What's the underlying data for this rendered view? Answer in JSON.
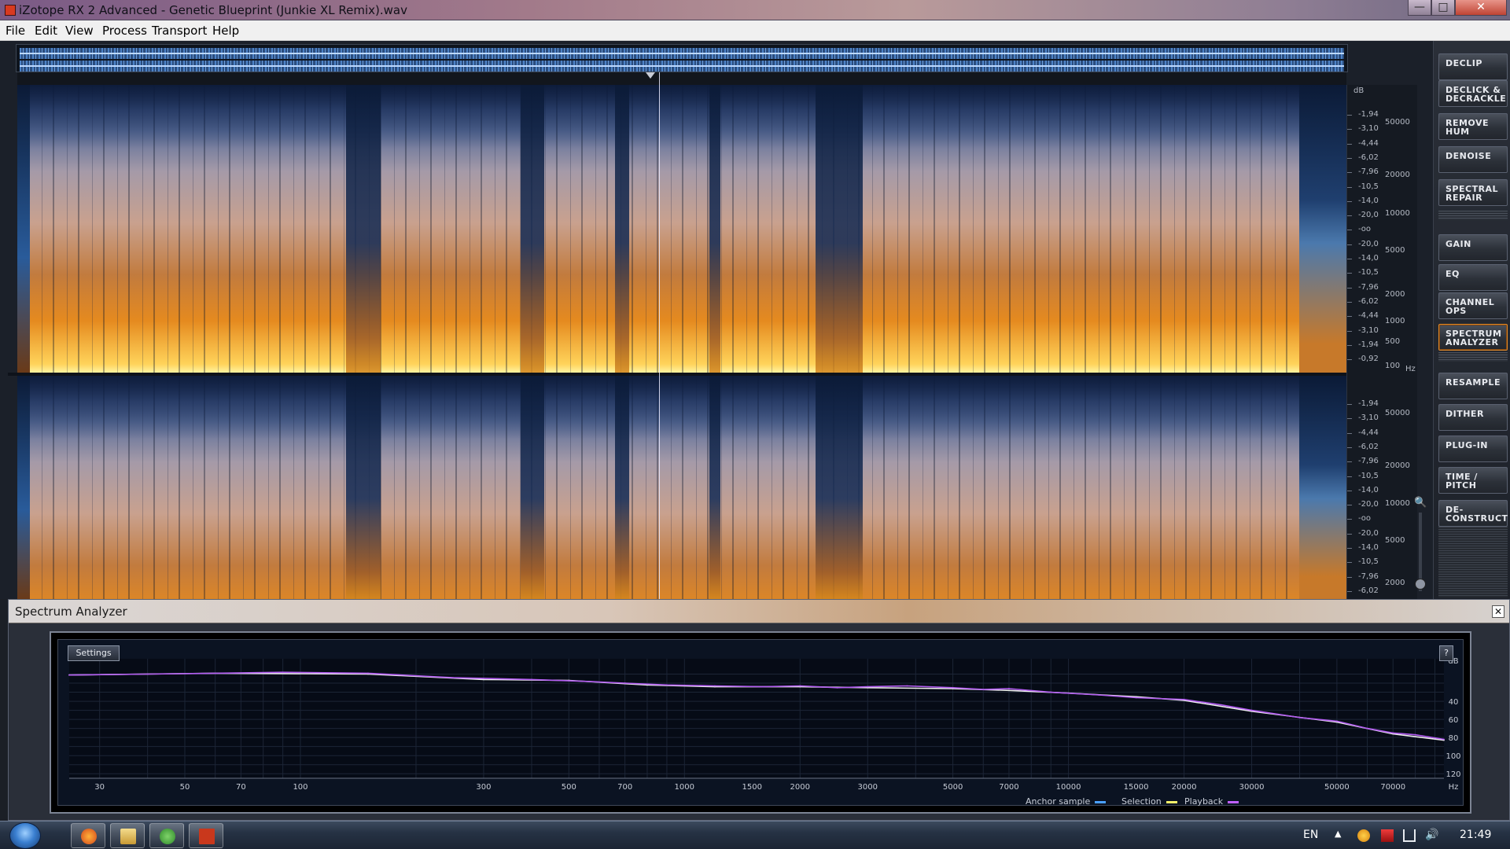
{
  "window": {
    "title": "iZotope RX 2 Advanced - Genetic Blueprint (Junkie XL Remix).wav",
    "controls": {
      "minimize": "—",
      "maximize": "□",
      "close": "✕"
    }
  },
  "menu": [
    "File",
    "Edit",
    "View",
    "Process",
    "Transport",
    "Help"
  ],
  "db_scale_label": "dB",
  "db_scale_top": [
    "-1,94",
    "-3,10",
    "-4,44",
    "-6,02",
    "-7,96",
    "-10,5",
    "-14,0",
    "-20,0",
    "-oo",
    "-20,0",
    "-14,0",
    "-10,5",
    "-7,96",
    "-6,02",
    "-4,44",
    "-3,10",
    "-1,94",
    "-0,92"
  ],
  "db_scale_bottom": [
    "-1,94",
    "-3,10",
    "-4,44",
    "-6,02",
    "-7,96",
    "-10,5",
    "-14,0",
    "-20,0",
    "-oo",
    "-20,0",
    "-14,0",
    "-10,5",
    "-7,96",
    "-6,02"
  ],
  "hz_scale_top": [
    "50000",
    "20000",
    "10000",
    "5000",
    "2000",
    "1000",
    "500",
    "100"
  ],
  "hz_scale_top_unit": "Hz",
  "hz_scale_bottom": [
    "50000",
    "20000",
    "10000",
    "5000",
    "2000"
  ],
  "tools": [
    {
      "label": "DECLIP",
      "active": false
    },
    {
      "label": "DECLICK & DECRACKLE",
      "active": false
    },
    {
      "label": "REMOVE HUM",
      "active": false
    },
    {
      "label": "DENOISE",
      "active": false
    },
    {
      "label": "SPECTRAL REPAIR",
      "active": false
    },
    {
      "label": "GAIN",
      "active": false
    },
    {
      "label": "EQ",
      "active": false
    },
    {
      "label": "CHANNEL OPS",
      "active": false
    },
    {
      "label": "SPECTRUM ANALYZER",
      "active": true
    },
    {
      "label": "RESAMPLE",
      "active": false
    },
    {
      "label": "DITHER",
      "active": false
    },
    {
      "label": "PLUG-IN",
      "active": false
    },
    {
      "label": "TIME / PITCH",
      "active": false
    },
    {
      "label": "DE-CONSTRUCT",
      "active": false
    }
  ],
  "analyzer": {
    "title": "Spectrum Analyzer",
    "settings_label": "Settings",
    "help_label": "?",
    "close_label": "✕",
    "legend": [
      {
        "label": "Anchor sample",
        "color": "#4aa0ff"
      },
      {
        "label": "Selection",
        "color": "#f4f06a"
      },
      {
        "label": "Playback",
        "color": "#c060ff"
      }
    ]
  },
  "chart_data": {
    "type": "line",
    "title": "",
    "xlabel": "Hz",
    "ylabel": "dB",
    "x_scale": "log",
    "xlim": [
      25,
      95000
    ],
    "ylim": [
      0,
      125
    ],
    "y_inverted": true,
    "x_ticks": [
      30,
      50,
      70,
      100,
      300,
      500,
      700,
      1000,
      1500,
      2000,
      3000,
      5000,
      7000,
      10000,
      15000,
      20000,
      30000,
      50000,
      70000
    ],
    "y_ticks": [
      40,
      60,
      80,
      100,
      120
    ],
    "grid": true,
    "legend_placement": "bottom-right",
    "series": [
      {
        "name": "Playback",
        "color": "#b25cf0",
        "x": [
          25,
          40,
          60,
          90,
          150,
          250,
          400,
          550,
          700,
          900,
          1200,
          1600,
          2000,
          2500,
          3000,
          3800,
          5000,
          6000,
          7000,
          9000,
          12000,
          15000,
          20000,
          25000,
          30000,
          40000,
          50000,
          60000,
          70000,
          80000,
          95000
        ],
        "values": [
          11,
          10,
          9,
          8,
          9,
          14,
          16,
          18,
          20,
          22,
          23,
          24,
          23,
          25,
          24,
          23,
          25,
          27,
          26,
          30,
          33,
          36,
          38,
          44,
          50,
          58,
          62,
          70,
          75,
          77,
          82
        ]
      },
      {
        "name": "Selection",
        "color": "#f0f0f0",
        "x": [
          25,
          60,
          150,
          300,
          500,
          800,
          1200,
          2000,
          3000,
          5000,
          7000,
          10000,
          15000,
          20000,
          30000,
          50000,
          70000,
          95000
        ],
        "values": [
          11,
          9,
          10,
          16,
          17,
          22,
          24,
          24,
          25,
          26,
          28,
          31,
          35,
          39,
          51,
          63,
          76,
          83
        ]
      }
    ]
  }
}
